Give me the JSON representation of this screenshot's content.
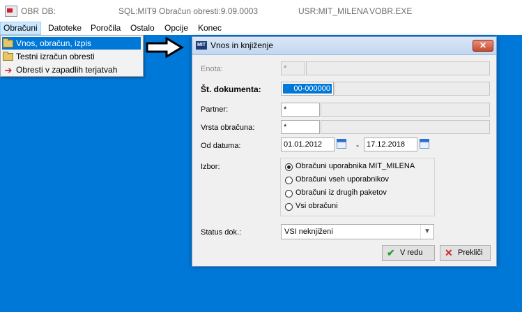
{
  "titlebar": {
    "app": "OBR",
    "db": "DB:",
    "sql": "SQL:MIT9",
    "calc": "Obračun obresti:9.09.0003",
    "user": "USR:MIT_MILENA",
    "exe": "VOBR.EXE"
  },
  "menu": {
    "items": [
      "Obračuni",
      "Datoteke",
      "Poročila",
      "Ostalo",
      "Opcije",
      "Konec"
    ]
  },
  "dropdown": {
    "items": [
      "Vnos, obračun, izpis",
      "Testni izračun obresti",
      "Obresti v zapadlih terjatvah"
    ]
  },
  "dialog": {
    "title": "Vnos in knjiženje",
    "icon_text": "MIT",
    "close": "✕",
    "enota_label": "Enota:",
    "enota_value": "*",
    "dokument_label": "Št. dokumenta:",
    "dokument_value": "00-000000",
    "partner_label": "Partner:",
    "partner_value": "*",
    "vrsta_label": "Vrsta obračuna:",
    "vrsta_value": "*",
    "datum_label": "Od datuma:",
    "date_from": "01.01.2012",
    "date_sep": "-",
    "date_to": "17.12.2018",
    "izbor_label": "Izbor:",
    "radio": [
      "Obračuni uporabnika MIT_MILENA",
      "Obračuni vseh uporabnikov",
      "Obračuni iz drugih paketov",
      "Vsi obračuni"
    ],
    "radio_selected": 0,
    "status_label": "Status dok.:",
    "status_value": "VSI neknjiženi",
    "ok_label": "V redu",
    "cancel_label": "Prekliči"
  },
  "colors": {
    "desktop": "#0078d7",
    "selection": "#0078d7",
    "ok_check": "#2e9b2e",
    "cancel_x": "#d22222"
  }
}
